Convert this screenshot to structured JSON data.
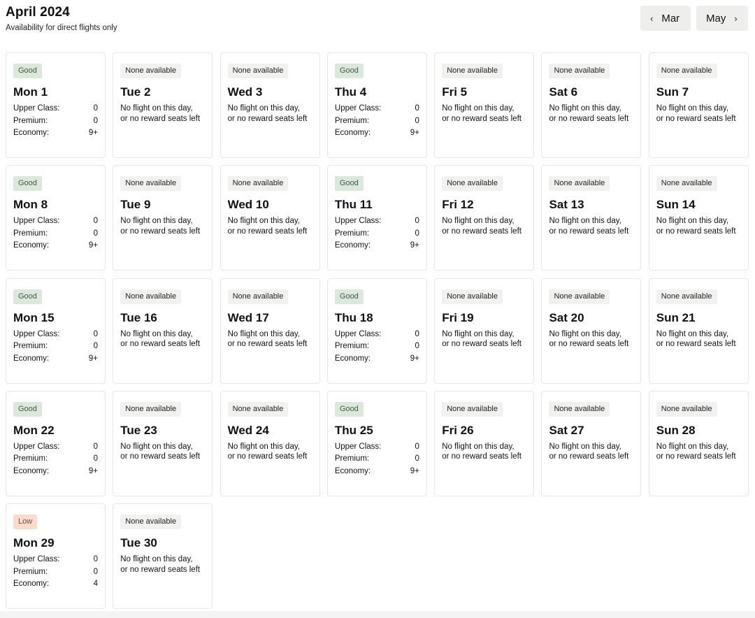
{
  "header": {
    "title": "April 2024",
    "subtitle": "Availability for direct flights only"
  },
  "nav": {
    "prev_label": "Mar",
    "next_label": "May",
    "prev_icon": "chevron-left-icon",
    "next_icon": "chevron-right-icon"
  },
  "labels": {
    "upper": "Upper Class:",
    "premium": "Premium:",
    "economy": "Economy:",
    "none_line1": "No flight on this day,",
    "none_line2": "or no reward seats left"
  },
  "colors": {
    "good_badge": "#dce8dc",
    "low_badge": "#f9dccd",
    "none_badge": "#f1f1ef"
  },
  "days": [
    {
      "day": "Mon 1",
      "status": "Good",
      "upper": "0",
      "premium": "0",
      "economy": "9+"
    },
    {
      "day": "Tue 2",
      "status": "None available"
    },
    {
      "day": "Wed 3",
      "status": "None available"
    },
    {
      "day": "Thu 4",
      "status": "Good",
      "upper": "0",
      "premium": "0",
      "economy": "9+"
    },
    {
      "day": "Fri 5",
      "status": "None available"
    },
    {
      "day": "Sat 6",
      "status": "None available"
    },
    {
      "day": "Sun 7",
      "status": "None available"
    },
    {
      "day": "Mon 8",
      "status": "Good",
      "upper": "0",
      "premium": "0",
      "economy": "9+"
    },
    {
      "day": "Tue 9",
      "status": "None available"
    },
    {
      "day": "Wed 10",
      "status": "None available"
    },
    {
      "day": "Thu 11",
      "status": "Good",
      "upper": "0",
      "premium": "0",
      "economy": "9+"
    },
    {
      "day": "Fri 12",
      "status": "None available"
    },
    {
      "day": "Sat 13",
      "status": "None available"
    },
    {
      "day": "Sun 14",
      "status": "None available"
    },
    {
      "day": "Mon 15",
      "status": "Good",
      "upper": "0",
      "premium": "0",
      "economy": "9+"
    },
    {
      "day": "Tue 16",
      "status": "None available"
    },
    {
      "day": "Wed 17",
      "status": "None available"
    },
    {
      "day": "Thu 18",
      "status": "Good",
      "upper": "0",
      "premium": "0",
      "economy": "9+"
    },
    {
      "day": "Fri 19",
      "status": "None available"
    },
    {
      "day": "Sat 20",
      "status": "None available"
    },
    {
      "day": "Sun 21",
      "status": "None available"
    },
    {
      "day": "Mon 22",
      "status": "Good",
      "upper": "0",
      "premium": "0",
      "economy": "9+"
    },
    {
      "day": "Tue 23",
      "status": "None available"
    },
    {
      "day": "Wed 24",
      "status": "None available"
    },
    {
      "day": "Thu 25",
      "status": "Good",
      "upper": "0",
      "premium": "0",
      "economy": "9+"
    },
    {
      "day": "Fri 26",
      "status": "None available"
    },
    {
      "day": "Sat 27",
      "status": "None available"
    },
    {
      "day": "Sun 28",
      "status": "None available"
    },
    {
      "day": "Mon 29",
      "status": "Low",
      "upper": "0",
      "premium": "0",
      "economy": "4"
    },
    {
      "day": "Tue 30",
      "status": "None available"
    }
  ]
}
